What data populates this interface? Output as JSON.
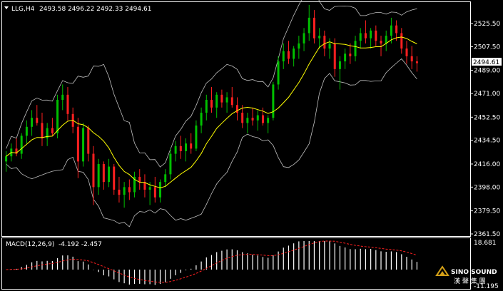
{
  "header": {
    "symbol": "LLG,H4",
    "ohlc": "2493.58 2496.22 2492.33 2494.61"
  },
  "indicator": {
    "label": "MACD(12,26,9)",
    "values": "-4.192 -2.457",
    "axis_top": "18.681",
    "axis_bottom": "-11.195"
  },
  "price_axis": {
    "labels": [
      "2525.50",
      "2507.50",
      "2489.00",
      "2471.00",
      "2452.50",
      "2434.50",
      "2416.00",
      "2398.00",
      "2379.50",
      "2361.50"
    ],
    "current_price": "2494.61"
  },
  "logo": {
    "line1": "SINO SOUND",
    "line2": "漢 聲 集 團"
  },
  "colors": {
    "bg": "#000000",
    "up": "#00c000",
    "down": "#ff2020",
    "ma": "#ffff00",
    "band": "#c0c0c0",
    "signal": "#ff2020",
    "hist": "#ffffff",
    "axis": "#ffffff",
    "logo": "#d4a017"
  },
  "chart_data": {
    "type": "candlestick",
    "ylim": [
      2361.5,
      2540.5
    ],
    "candles": [
      [
        2418,
        2426,
        2410,
        2422
      ],
      [
        2422,
        2432,
        2418,
        2428
      ],
      [
        2428,
        2436,
        2422,
        2424
      ],
      [
        2424,
        2440,
        2420,
        2438
      ],
      [
        2438,
        2450,
        2432,
        2445
      ],
      [
        2445,
        2458,
        2438,
        2452
      ],
      [
        2452,
        2462,
        2446,
        2448
      ],
      [
        2448,
        2456,
        2430,
        2436
      ],
      [
        2436,
        2448,
        2430,
        2444
      ],
      [
        2444,
        2452,
        2438,
        2440
      ],
      [
        2440,
        2470,
        2436,
        2466
      ],
      [
        2466,
        2478,
        2458,
        2470
      ],
      [
        2470,
        2476,
        2450,
        2455
      ],
      [
        2455,
        2460,
        2440,
        2445
      ],
      [
        2445,
        2452,
        2405,
        2418
      ],
      [
        2418,
        2448,
        2414,
        2444
      ],
      [
        2444,
        2446,
        2418,
        2424
      ],
      [
        2424,
        2430,
        2384,
        2398
      ],
      [
        2398,
        2420,
        2392,
        2416
      ],
      [
        2416,
        2418,
        2396,
        2402
      ],
      [
        2402,
        2420,
        2398,
        2414
      ],
      [
        2414,
        2416,
        2392,
        2396
      ],
      [
        2396,
        2406,
        2386,
        2392
      ],
      [
        2392,
        2402,
        2382,
        2398
      ],
      [
        2398,
        2404,
        2388,
        2394
      ],
      [
        2394,
        2410,
        2390,
        2406
      ],
      [
        2406,
        2412,
        2396,
        2402
      ],
      [
        2402,
        2408,
        2390,
        2396
      ],
      [
        2396,
        2402,
        2384,
        2398
      ],
      [
        2398,
        2406,
        2386,
        2390
      ],
      [
        2390,
        2404,
        2386,
        2402
      ],
      [
        2402,
        2412,
        2398,
        2408
      ],
      [
        2408,
        2428,
        2404,
        2424
      ],
      [
        2424,
        2434,
        2418,
        2430
      ],
      [
        2430,
        2438,
        2420,
        2426
      ],
      [
        2426,
        2436,
        2418,
        2432
      ],
      [
        2432,
        2440,
        2424,
        2428
      ],
      [
        2428,
        2450,
        2426,
        2446
      ],
      [
        2446,
        2460,
        2440,
        2456
      ],
      [
        2456,
        2470,
        2450,
        2466
      ],
      [
        2466,
        2476,
        2456,
        2460
      ],
      [
        2460,
        2472,
        2452,
        2470
      ],
      [
        2470,
        2474,
        2460,
        2464
      ],
      [
        2464,
        2472,
        2456,
        2468
      ],
      [
        2468,
        2476,
        2460,
        2462
      ],
      [
        2462,
        2468,
        2450,
        2456
      ],
      [
        2456,
        2462,
        2444,
        2448
      ],
      [
        2448,
        2456,
        2440,
        2452
      ],
      [
        2452,
        2460,
        2446,
        2450
      ],
      [
        2450,
        2458,
        2442,
        2454
      ],
      [
        2454,
        2460,
        2446,
        2448
      ],
      [
        2448,
        2454,
        2440,
        2452
      ],
      [
        2452,
        2480,
        2450,
        2478
      ],
      [
        2478,
        2500,
        2474,
        2496
      ],
      [
        2496,
        2510,
        2490,
        2504
      ],
      [
        2504,
        2512,
        2494,
        2498
      ],
      [
        2498,
        2508,
        2492,
        2506
      ],
      [
        2506,
        2516,
        2498,
        2510
      ],
      [
        2510,
        2522,
        2504,
        2518
      ],
      [
        2518,
        2540,
        2512,
        2530
      ],
      [
        2530,
        2536,
        2510,
        2514
      ],
      [
        2514,
        2522,
        2506,
        2516
      ],
      [
        2516,
        2520,
        2500,
        2506
      ],
      [
        2506,
        2514,
        2498,
        2510
      ],
      [
        2510,
        2514,
        2484,
        2490
      ],
      [
        2490,
        2500,
        2474,
        2496
      ],
      [
        2496,
        2506,
        2490,
        2502
      ],
      [
        2502,
        2510,
        2494,
        2500
      ],
      [
        2500,
        2516,
        2496,
        2512
      ],
      [
        2512,
        2522,
        2506,
        2518
      ],
      [
        2518,
        2528,
        2510,
        2514
      ],
      [
        2514,
        2522,
        2506,
        2520
      ],
      [
        2520,
        2524,
        2508,
        2512
      ],
      [
        2512,
        2516,
        2500,
        2510
      ],
      [
        2510,
        2520,
        2504,
        2516
      ],
      [
        2516,
        2530,
        2510,
        2524
      ],
      [
        2524,
        2528,
        2512,
        2518
      ],
      [
        2518,
        2522,
        2502,
        2506
      ],
      [
        2506,
        2512,
        2494,
        2500
      ],
      [
        2500,
        2508,
        2490,
        2496
      ],
      [
        2496,
        2500,
        2488,
        2494.61
      ]
    ]
  }
}
